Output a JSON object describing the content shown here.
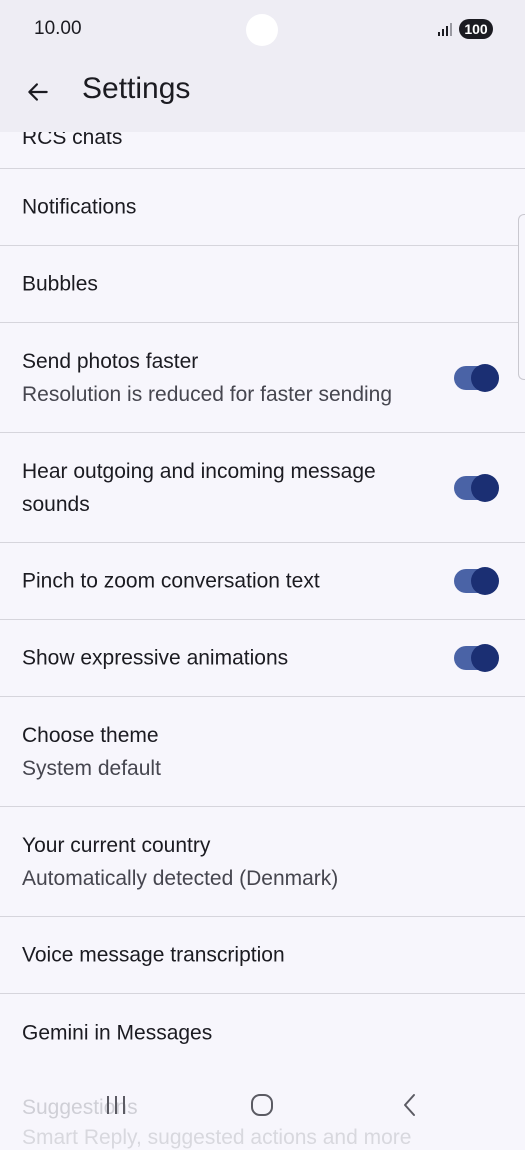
{
  "status": {
    "time": "10.00",
    "battery": "100"
  },
  "header": {
    "title": "Settings"
  },
  "list": {
    "partial_top_label": "RCS chats",
    "items": [
      {
        "primary": "Notifications"
      },
      {
        "primary": "Bubbles"
      },
      {
        "primary": "Send photos faster",
        "secondary": "Resolution is reduced for faster sending",
        "toggle": true
      },
      {
        "primary": "Hear outgoing and incoming message",
        "primary2": "sounds",
        "toggle": true
      },
      {
        "primary": "Pinch to zoom conversation text",
        "toggle": true
      },
      {
        "primary": "Show expressive animations",
        "toggle": true
      },
      {
        "primary": "Choose theme",
        "secondary": "System default"
      },
      {
        "primary": "Your current country",
        "secondary": "Automatically detected (Denmark)"
      },
      {
        "primary": "Voice message transcription"
      },
      {
        "primary": "Gemini in Messages"
      }
    ],
    "partial_bottom": {
      "primary": "Suggestions",
      "secondary": "Smart Reply, suggested actions and more"
    }
  },
  "colors": {
    "toggle_track": "#4a63a6",
    "toggle_thumb": "#1b2f73",
    "background": "#f7f6fc"
  },
  "icons": {
    "back": "arrow-left",
    "recents": "recent-apps",
    "home": "home-circle",
    "nav_back": "chevron-left"
  }
}
